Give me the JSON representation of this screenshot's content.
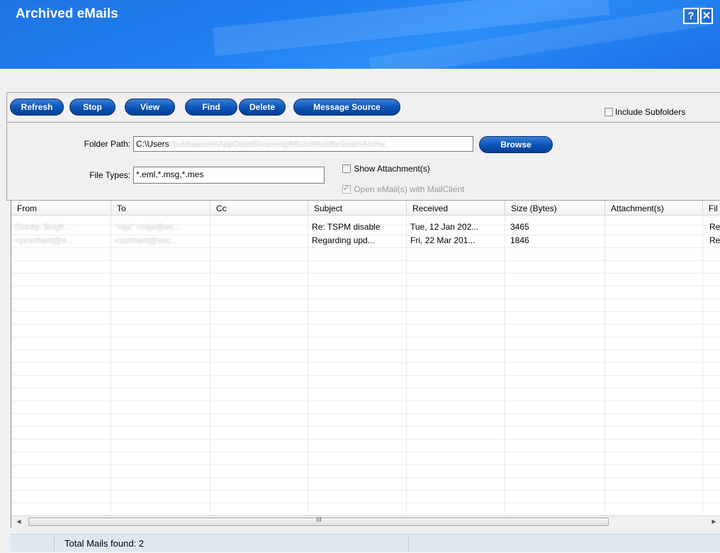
{
  "window": {
    "title": "Archived eMails",
    "help_label": "?",
    "close_label": "✕"
  },
  "toolbar": {
    "buttons": {
      "refresh": "Refresh",
      "stop": "Stop",
      "view": "View",
      "find": "Find",
      "delete": "Delete",
      "message_source": "Message Source"
    },
    "include_subfolders": {
      "label": "Include Subfolders",
      "checked": false
    }
  },
  "folder": {
    "path_label": "Folder Path:",
    "path_value_visible": "C:\\Users",
    "path_value_blurred": "\\Subhalaxmi\\AppData\\Roaming\\MicroWorld\\eScan\\Archiv",
    "browse_label": "Browse",
    "file_types_label": "File Types:",
    "file_types_value": "*.eml,*.msg,*.mes",
    "show_attachments": {
      "label": "Show Attachment(s)",
      "checked": false
    },
    "open_mailclient": {
      "label": "Open eMail(s) with MailClient",
      "checked": true,
      "disabled": true
    }
  },
  "grid": {
    "columns": [
      "From",
      "To",
      "Cc",
      "Subject",
      "Received",
      "Size (Bytes)",
      "Attachment(s)",
      "Fil"
    ],
    "rows": [
      {
        "from": "Gurdip Singh ...",
        "to": "\"raja\" <raja@es...",
        "cc": "",
        "subject": "Re: TSPM disable",
        "received": "Tue, 12 Jan 202...",
        "size": "3465",
        "attachments": "",
        "file": "Re"
      },
      {
        "from": "<prashant@e...",
        "to": "<sushant@esc...",
        "cc": "",
        "subject": "Regarding upd...",
        "received": "Fri, 22 Mar 201...",
        "size": "1846",
        "attachments": "",
        "file": "Re"
      }
    ]
  },
  "scrollbar": {
    "left_arrow": "◀",
    "right_arrow": "▶",
    "grip": "III"
  },
  "status": {
    "total_label": "Total Mails found: 2"
  },
  "colors": {
    "title_blue": "#1f7ef0",
    "button_blue": "#0e56b8"
  }
}
